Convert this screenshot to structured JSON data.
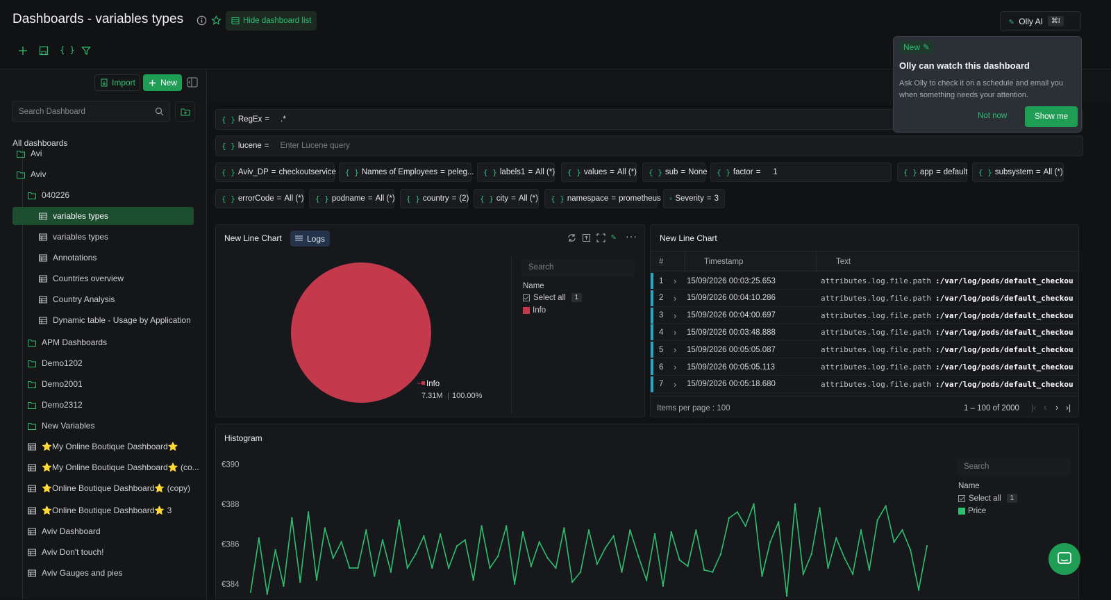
{
  "header": {
    "title": "Dashboards - variables types",
    "hide_list_label": "Hide dashboard list",
    "olly_label": "Olly AI",
    "olly_kbd": "⌘I"
  },
  "olly_popup": {
    "badge": "New",
    "title": "Olly can watch this dashboard",
    "body_line1": "Ask Olly to check it on a schedule and email you",
    "body_line2": "when something needs your attention.",
    "not_now": "Not now",
    "show_me": "Show me"
  },
  "sidebar": {
    "import_label": "Import",
    "new_label": "New",
    "search_placeholder": "Search Dashboard",
    "section_title": "All dashboards",
    "items": [
      {
        "label": "Avi",
        "type": "folder",
        "indent": 0
      },
      {
        "label": "Aviv",
        "type": "folder",
        "indent": 0
      },
      {
        "label": "040226",
        "type": "folder",
        "indent": 1
      },
      {
        "label": "variables types",
        "type": "dash",
        "indent": 2,
        "active": true
      },
      {
        "label": "variables types",
        "type": "dash",
        "indent": 2
      },
      {
        "label": "Annotations",
        "type": "dash",
        "indent": 2
      },
      {
        "label": "Countries overview",
        "type": "dash",
        "indent": 2
      },
      {
        "label": "Country Analysis",
        "type": "dash",
        "indent": 2
      },
      {
        "label": "Dynamic table - Usage by Application",
        "type": "dash",
        "indent": 2
      },
      {
        "label": "APM Dashboards",
        "type": "folder",
        "indent": 1
      },
      {
        "label": "Demo1202",
        "type": "folder",
        "indent": 1
      },
      {
        "label": "Demo2001",
        "type": "folder",
        "indent": 1
      },
      {
        "label": "Demo2312",
        "type": "folder",
        "indent": 1
      },
      {
        "label": "New Variables",
        "type": "folder",
        "indent": 1
      },
      {
        "label": "⭐My Online Boutique Dashboard⭐",
        "type": "dash",
        "indent": 1
      },
      {
        "label": "⭐My Online Boutique Dashboard⭐ (co...",
        "type": "dash",
        "indent": 1
      },
      {
        "label": "⭐Online Boutique Dashboard⭐ (copy)",
        "type": "dash",
        "indent": 1
      },
      {
        "label": "⭐Online Boutique Dashboard⭐ 3",
        "type": "dash",
        "indent": 1
      },
      {
        "label": "Aviv Dashboard",
        "type": "dash",
        "indent": 1
      },
      {
        "label": "Aviv Don't touch!",
        "type": "dash",
        "indent": 1
      },
      {
        "label": "Aviv Gauges and pies",
        "type": "dash",
        "indent": 1
      }
    ]
  },
  "vars": {
    "regex": {
      "name": "RegEx",
      "value": ".*"
    },
    "lucene": {
      "name": "lucene",
      "placeholder": "Enter Lucene query"
    },
    "row1": [
      {
        "name": "Aviv_DP",
        "value": "checkoutservice"
      },
      {
        "name": "Names of Employees",
        "value": "peleg..."
      },
      {
        "name": "labels1",
        "value": "All (*)"
      },
      {
        "name": "values",
        "value": "All (*)"
      },
      {
        "name": "sub",
        "value": "None"
      },
      {
        "name": "factor",
        "value": "1"
      },
      {
        "name": "app",
        "value": "default"
      },
      {
        "name": "subsystem",
        "value": "All (*)"
      }
    ],
    "row2": [
      {
        "name": "errorCode",
        "value": "All (*)"
      },
      {
        "name": "podname",
        "value": "All (*)"
      },
      {
        "name": "country",
        "value": "(2)"
      },
      {
        "name": "city",
        "value": "All (*)"
      },
      {
        "name": "namespace",
        "value": "prometheus"
      },
      {
        "name": "Severity",
        "value": "3"
      }
    ]
  },
  "pie_panel": {
    "title": "New Line Chart",
    "tag": "Logs",
    "search_placeholder": "Search",
    "legend_name": "Name",
    "select_all": "Select all",
    "select_count": "1",
    "series": "Info",
    "label_name": "Info",
    "label_value": "7.31M",
    "label_pct": "100.00%",
    "color": "#c4394b"
  },
  "table_panel": {
    "title": "New Line Chart",
    "columns": [
      "#",
      "Timestamp",
      "Text"
    ],
    "rows": [
      {
        "n": "1",
        "ts": "15/09/2026 00:03:25.653",
        "key": "attributes.log.file.path",
        "val": ":/var/log/pods/default_checkou"
      },
      {
        "n": "2",
        "ts": "15/09/2026 00:04:10.286",
        "key": "attributes.log.file.path",
        "val": ":/var/log/pods/default_checkou"
      },
      {
        "n": "3",
        "ts": "15/09/2026 00:04:00.697",
        "key": "attributes.log.file.path",
        "val": ":/var/log/pods/default_checkou"
      },
      {
        "n": "4",
        "ts": "15/09/2026 00:03:48.888",
        "key": "attributes.log.file.path",
        "val": ":/var/log/pods/default_checkou"
      },
      {
        "n": "5",
        "ts": "15/09/2026 00:05:05.087",
        "key": "attributes.log.file.path",
        "val": ":/var/log/pods/default_checkou"
      },
      {
        "n": "6",
        "ts": "15/09/2026 00:05:05.113",
        "key": "attributes.log.file.path",
        "val": ":/var/log/pods/default_checkou"
      },
      {
        "n": "7",
        "ts": "15/09/2026 00:05:18.680",
        "key": "attributes.log.file.path",
        "val": ":/var/log/pods/default_checkou"
      }
    ],
    "items_per_page": "Items per page : 100",
    "range": "1 – 100 of 2000"
  },
  "histogram": {
    "title": "Histogram",
    "search_placeholder": "Search",
    "legend_name": "Name",
    "select_all": "Select all",
    "select_count": "1",
    "series": "Price",
    "color": "#2fbf71"
  },
  "chart_data": {
    "type": "line",
    "title": "Histogram",
    "yticks": [
      "€390",
      "€388",
      "€386",
      "€384"
    ],
    "ylim": [
      383.2,
      390.6
    ],
    "series": [
      {
        "name": "Price",
        "values": [
          383.6,
          386.3,
          383.5,
          385.7,
          383.9,
          387.3,
          384.1,
          387.6,
          384.2,
          386.8,
          385.3,
          386.1,
          384.8,
          384.8,
          386.7,
          384.4,
          386.2,
          384.6,
          387.2,
          384.8,
          385.5,
          386.4,
          384.8,
          386.5,
          384.8,
          385.9,
          386.2,
          384.2,
          386.9,
          384.8,
          385.4,
          386.9,
          384.0,
          386.6,
          384.9,
          386.1,
          385.3,
          384.8,
          386.8,
          384.1,
          384.6,
          386.7,
          385.0,
          385.8,
          386.4,
          384.6,
          386.7,
          385.4,
          384.2,
          386.5,
          383.9,
          386.6,
          385.2,
          384.9,
          386.7,
          384.7,
          384.6,
          385.5,
          387.3,
          387.6,
          386.9,
          388.0,
          384.4,
          386.1,
          387.1,
          383.4,
          388.0,
          384.5,
          385.5,
          387.8,
          384.8,
          386.3,
          385.3,
          384.5,
          386.7,
          384.7,
          387.2,
          387.9,
          386.1,
          386.7,
          385.7,
          383.7,
          385.9
        ]
      }
    ]
  }
}
